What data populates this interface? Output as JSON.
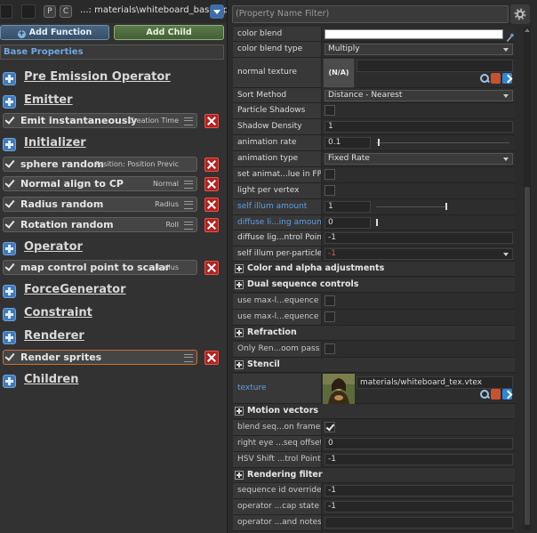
{
  "left": {
    "filepath": "...: materials\\whiteboard_base.vpcf",
    "letter_buttons": [
      "P",
      "C"
    ],
    "add_function_label": "Add Function",
    "add_child_label": "Add Child",
    "base_properties_label": "Base Properties",
    "sections": {
      "pre_emission": "Pre Emission Operator",
      "emitter": "Emitter",
      "initializer": "Initializer",
      "operator": "Operator",
      "force_generator": "ForceGenerator",
      "constraint": "Constraint",
      "renderer": "Renderer",
      "children": "Children"
    },
    "ops": {
      "emit_instantaneously": {
        "label": "Emit instantaneously",
        "param": "Creation Time"
      },
      "sphere_random": {
        "label": "sphere random",
        "param": "Position: Position Previc"
      },
      "normal_align": {
        "label": "Normal align to CP",
        "param": "Normal"
      },
      "radius_random": {
        "label": "Radius random",
        "param": "Radius"
      },
      "rotation_random": {
        "label": "Rotation random",
        "param": "Roll"
      },
      "map_control_point": {
        "label": "map control point to scalar",
        "param": "Radius"
      },
      "render_sprites": {
        "label": "Render sprites",
        "param": ""
      }
    }
  },
  "right": {
    "filter_placeholder": "(Property Name Filter)",
    "props": {
      "color_blend": {
        "label": "color blend"
      },
      "color_blend_type": {
        "label": "color blend type",
        "value": "Multiply"
      },
      "normal_texture": {
        "label": "normal texture",
        "thumb_text": "(N/A)"
      },
      "sort_method": {
        "label": "Sort Method",
        "value": "Distance - Nearest"
      },
      "particle_shadows": {
        "label": "Particle Shadows"
      },
      "shadow_density": {
        "label": "Shadow Density",
        "value": "1"
      },
      "animation_rate": {
        "label": "animation rate",
        "value": "0.1",
        "slider": 0.01
      },
      "animation_type": {
        "label": "animation type",
        "value": "Fixed Rate"
      },
      "set_anim_fps": {
        "label": "set animat...lue in FPS"
      },
      "light_per_vertex": {
        "label": "light per vertex"
      },
      "self_illum_amount": {
        "label": "self illum amount",
        "value": "1",
        "slider": 1.0
      },
      "diffuse_lighting_amount": {
        "label": "diffuse li...ing amount",
        "value": "0",
        "slider": 0.0
      },
      "diffuse_lighting_cp": {
        "label": "diffuse lig...ntrol Point",
        "value": "-1"
      },
      "self_illum_per_particle": {
        "label": "self illum per-particle",
        "value": "-1"
      },
      "dual_seq_0": {
        "label": "use max-l...equence 0"
      },
      "dual_seq_1": {
        "label": "use max-l...equence 1"
      },
      "only_render_zoom": {
        "label": "Only Ren...oom pass"
      },
      "texture": {
        "label": "texture",
        "value": "materials/whiteboard_tex.vtex"
      },
      "blend_seq_frames": {
        "label": "blend seq...on frames"
      },
      "right_eye_seq_offset": {
        "label": "right eye ...seq offset",
        "value": "0"
      },
      "hsv_shift_cp": {
        "label": "HSV Shift ...trol Point",
        "value": "-1"
      },
      "sequence_id_override": {
        "label": "sequence id override",
        "value": "-1"
      },
      "operator_cap_state": {
        "label": "operator ...cap state",
        "value": "-1"
      },
      "operator_notes": {
        "label": "operator ...and notes",
        "value": ""
      }
    },
    "groups": {
      "color_alpha": "Color and alpha adjustments",
      "dual_sequence": "Dual sequence controls",
      "refraction": "Refraction",
      "stencil": "Stencil",
      "motion_vectors": "Motion vectors",
      "rendering_filter": "Rendering filter"
    },
    "colors": {
      "accent_blue": "#5d9fe4",
      "selected_border": "#c9712c",
      "delete_red": "#b3231f"
    }
  }
}
